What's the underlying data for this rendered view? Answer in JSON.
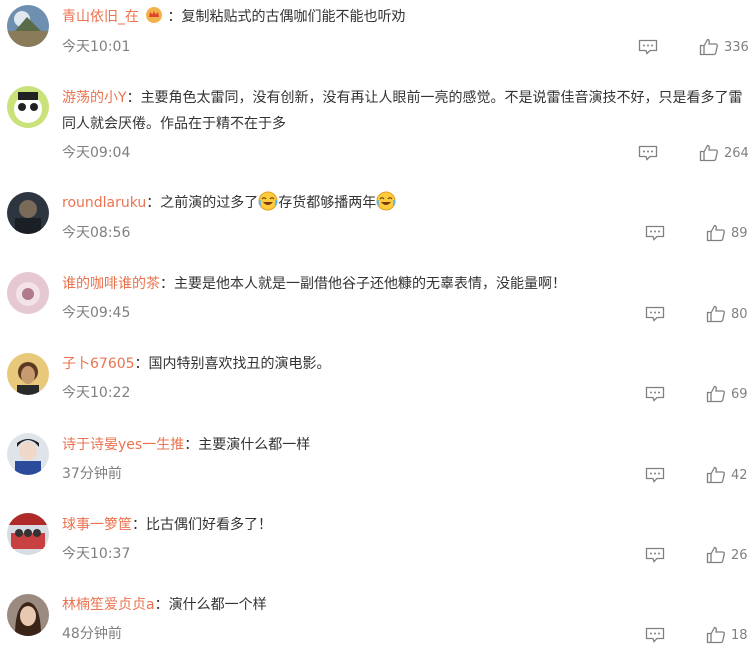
{
  "comments": [
    {
      "user": "青山依旧_在",
      "sep": "：",
      "text": "复制粘贴式的古偶咖们能不能也听劝",
      "time": "今天10:01",
      "likes": "336"
    },
    {
      "user": "游荡的小Y",
      "sep": "：",
      "text": "主要角色太雷同，没有创新，没有再让人眼前一亮的感觉。不是说雷佳音演技不好，只是看多了雷同人就会厌倦。作品在于精不在于多",
      "time": "今天09:04",
      "likes": "264"
    },
    {
      "user": "roundlaruku",
      "sep": "：",
      "text_a": "之前演的过多了",
      "text_b": "存货都够播两年",
      "time": "今天08:56",
      "likes": "89"
    },
    {
      "user": "谁的咖啡谁的茶",
      "sep": "：",
      "text": "主要是他本人就是一副借他谷子还他糠的无辜表情，没能量啊！",
      "time": "今天09:45",
      "likes": "80"
    },
    {
      "user": "子卜67605",
      "sep": "：",
      "text": "国内特别喜欢找丑的演电影。",
      "time": "今天10:22",
      "likes": "69"
    },
    {
      "user": "诗于诗晏yes一生推",
      "sep": "：",
      "text": "主要演什么都一样",
      "time": "37分钟前",
      "likes": "42"
    },
    {
      "user": "球事一箩筐",
      "sep": "：",
      "text": "比古偶们好看多了！",
      "time": "今天10:37",
      "likes": "26"
    },
    {
      "user": "林楠笙爱贞贞a",
      "sep": "：",
      "text": "演什么都一个样",
      "time": "48分钟前",
      "likes": "18"
    }
  ]
}
